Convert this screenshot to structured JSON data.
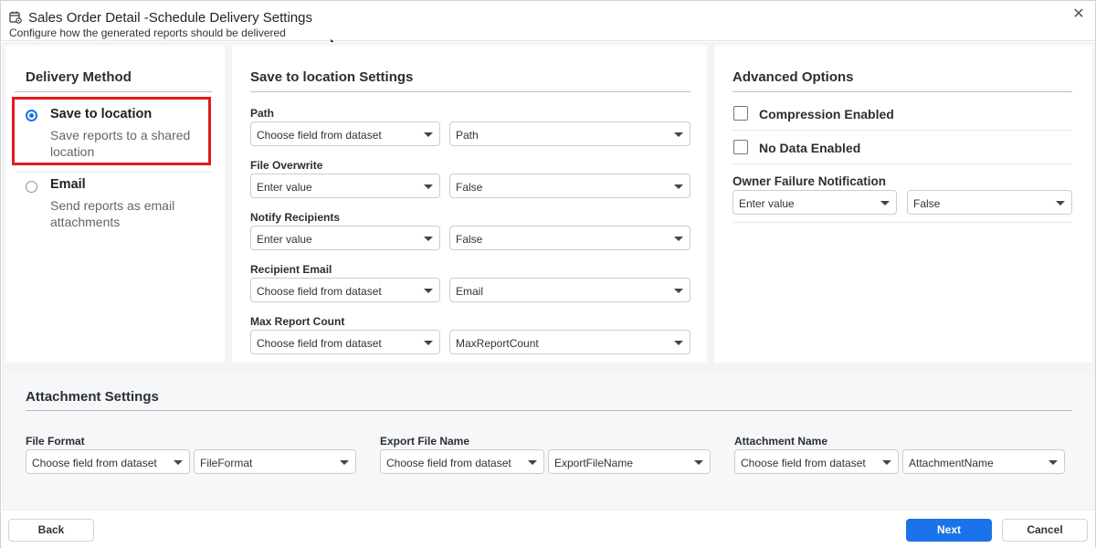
{
  "window": {
    "title": "Sales Order Detail -Schedule Delivery Settings",
    "subtitle": "Configure how the generated reports should be delivered",
    "close_glyph": "✕",
    "icon": "calendar-gear-icon"
  },
  "delivery_method": {
    "title": "Delivery Method",
    "selected": "save_to_location",
    "options": [
      {
        "title": "Save to location",
        "desc": "Save reports to a shared location"
      },
      {
        "title": "Email",
        "desc": "Send reports as email attachments"
      }
    ]
  },
  "location_settings": {
    "title": "Save to location Settings",
    "fields": [
      {
        "label": "Path",
        "source": "Choose field from dataset",
        "value": "Path"
      },
      {
        "label": "File Overwrite",
        "source": "Enter value",
        "value": "False"
      },
      {
        "label": "Notify Recipients",
        "source": "Enter value",
        "value": "False"
      },
      {
        "label": "Recipient Email",
        "source": "Choose field from dataset",
        "value": "Email"
      },
      {
        "label": "Max Report Count",
        "source": "Choose field from dataset",
        "value": "MaxReportCount"
      }
    ]
  },
  "advanced": {
    "title": "Advanced Options",
    "compression_label": "Compression Enabled",
    "compression_checked": false,
    "no_data_label": "No Data Enabled",
    "no_data_checked": false,
    "owner_failure": {
      "label": "Owner Failure Notification",
      "source": "Enter value",
      "value": "False"
    }
  },
  "attachment": {
    "title": "Attachment Settings",
    "fields": [
      {
        "label": "File Format",
        "source": "Choose field from dataset",
        "value": "FileFormat"
      },
      {
        "label": "Export File Name",
        "source": "Choose field from dataset",
        "value": "ExportFileName"
      },
      {
        "label": "Attachment Name",
        "source": "Choose field from dataset",
        "value": "AttachmentName"
      }
    ]
  },
  "footer": {
    "back_label": "Back",
    "next_label": "Next",
    "cancel_label": "Cancel"
  },
  "colors": {
    "accent": "#1a73e8",
    "highlight": "#e31b1b"
  }
}
